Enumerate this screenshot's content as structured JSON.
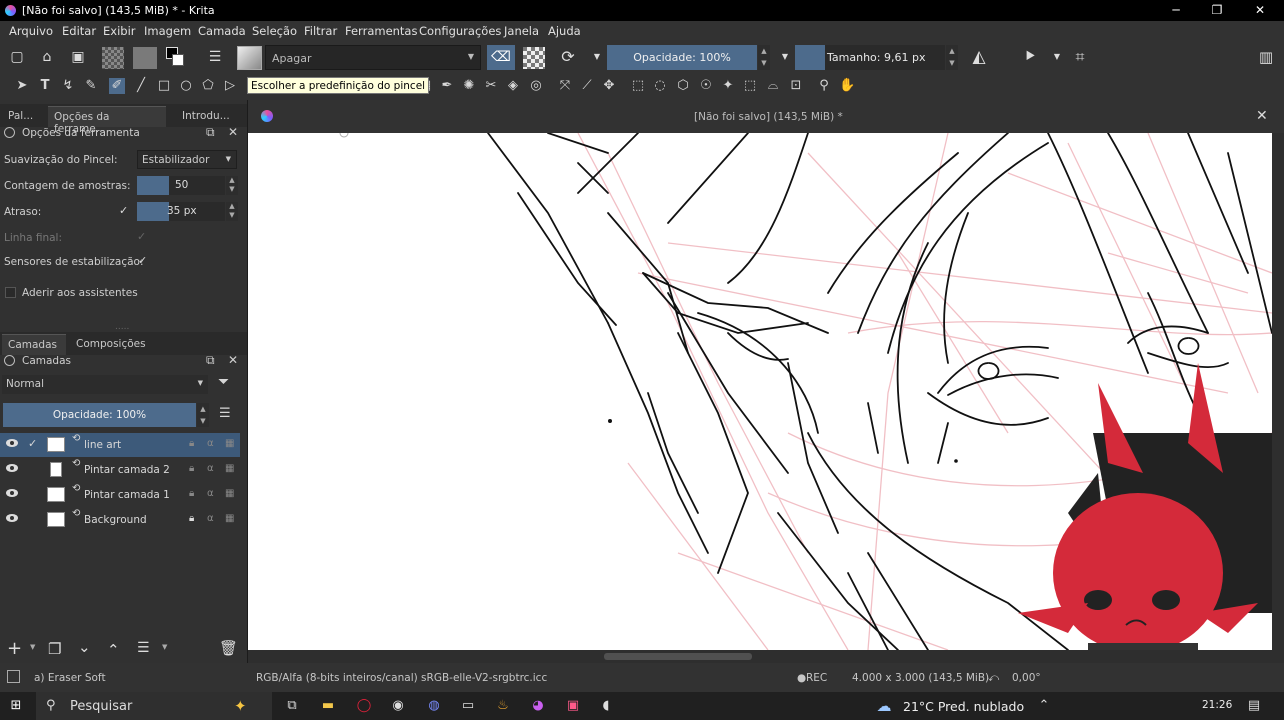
{
  "window": {
    "title": "[Não foi salvo]  (143,5 MiB) * - Krita"
  },
  "menu": [
    "Arquivo",
    "Editar",
    "Exibir",
    "Imagem",
    "Camada",
    "Seleção",
    "Filtrar",
    "Ferramentas",
    "Configurações",
    "Janela",
    "Ajuda"
  ],
  "toolbar": {
    "blend_mode": "Apagar",
    "opacity": "Opacidade: 100%",
    "size": "Tamanho: 9,61 px",
    "tooltip": "Escolher a predefinição do pincel"
  },
  "left_tabs": [
    "Pal...",
    "Opções da ferrame...",
    "Introdu..."
  ],
  "tool_options": {
    "header": "Opções da ferramenta",
    "smoothing_label": "Suavização do Pincel:",
    "smoothing_value": "Estabilizador",
    "samples_label": "Contagem de amostras:",
    "samples_value": "50",
    "delay_label": "Atraso:",
    "delay_value": "35 px",
    "finish_line_label": "Linha final:",
    "sensors_label": "Sensores de estabilização:",
    "snap_label": "Aderir aos assistentes"
  },
  "layers_tabs": [
    "Camadas",
    "Composições"
  ],
  "layers": {
    "header": "Camadas",
    "blend": "Normal",
    "opacity": "Opacidade:  100%",
    "items": [
      {
        "name": "line art",
        "selected": true
      },
      {
        "name": "Pintar camada 2",
        "selected": false
      },
      {
        "name": "Pintar camada 1",
        "selected": false
      },
      {
        "name": "Background",
        "selected": false
      }
    ]
  },
  "document": {
    "tab_title": "[Não foi salvo]  (143,5 MiB) *"
  },
  "status": {
    "brush": "a) Eraser Soft",
    "color_info": "RGB/Alfa (8-bits inteiros/canal)  sRGB-elle-V2-srgbtrc.icc",
    "rec": "REC",
    "dimensions": "4.000 x 3.000 (143,5 MiB)",
    "rotation": "0,00°"
  },
  "taskbar": {
    "search": "Pesquisar",
    "weather": "21°C  Pred. nublado",
    "time": "21:26"
  },
  "colors": {
    "accent": "#4d6b8c",
    "sketch_red": "#e8a0a8",
    "mascot_red": "#d42a3a"
  }
}
